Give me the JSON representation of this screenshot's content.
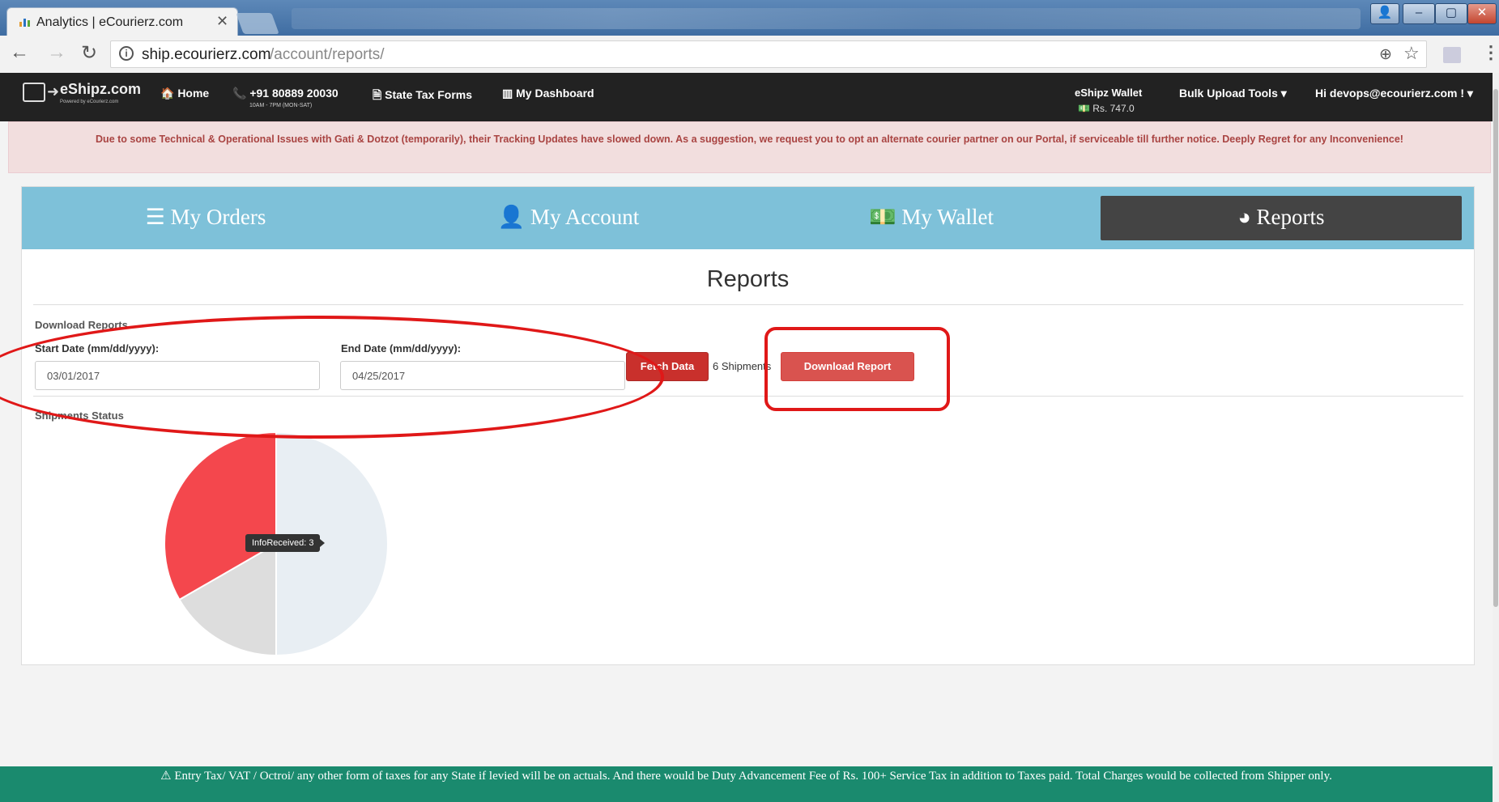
{
  "browser": {
    "tab_title": "Analytics | eCourierz.com",
    "tab_close": "✕",
    "url_host": "ship.ecourierz.com",
    "url_path": "/account/reports/"
  },
  "navbar": {
    "logo": "eShipz.com",
    "logo_sub": "Powered by eCourierz.com",
    "home": "🏠 Home",
    "phone": "📞 +91 80889 20030",
    "phone_hours": "10AM - 7PM (MON-SAT)",
    "tax_forms": "🗎 State Tax Forms",
    "dashboard": "▥ My Dashboard",
    "wallet_label": "eShipz Wallet",
    "wallet_balance": "💵 Rs. 747.0",
    "bulk_upload": "Bulk Upload Tools ▾",
    "user": "Hi devops@ecourierz.com ! ▾"
  },
  "banner_text": "Due to some Technical & Operational Issues with Gati & Dotzot (temporarily), their Tracking Updates have slowed down. As a suggestion, we request you to opt an alternate courier partner on our Portal, if serviceable till further notice. Deeply Regret for any Inconvenience!",
  "tabs": {
    "orders": "☰ My Orders",
    "account": "👤 My Account",
    "wallet": "💵 My Wallet",
    "reports": "◕ Reports"
  },
  "reports": {
    "heading": "Reports",
    "download_reports": "Download Reports",
    "start_label": "Start Date (mm/dd/yyyy):",
    "start_value": "03/01/2017",
    "end_label": "End Date (mm/dd/yyyy):",
    "end_value": "04/25/2017",
    "fetch_button": "Fetch Data",
    "shipments_count": "6 Shipments",
    "download_button": "Download Report",
    "status_label": "Shipments Status",
    "tooltip": "InfoReceived: 3"
  },
  "chart_data": {
    "type": "pie",
    "slices": [
      {
        "value": 3,
        "color": "#e8eef3"
      },
      {
        "value": 1,
        "color": "#dddddd"
      },
      {
        "value": 2,
        "color": "#f4474d"
      }
    ]
  },
  "footer_text": "⚠ Entry Tax/ VAT / Octroi/ any other form of taxes for any State if levied will be on actuals. And there would be Duty Advancement Fee of Rs. 100+ Service Tax in addition to Taxes paid. Total Charges would be collected from Shipper only."
}
